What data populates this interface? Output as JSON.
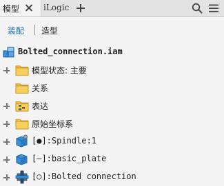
{
  "tabs": {
    "model_label": "模型",
    "ilogic_label": "iLogic"
  },
  "toolbar": {
    "assembly_label": "装配",
    "modeling_label": "造型"
  },
  "tree": {
    "root_label": "Bolted_connection.iam",
    "items": [
      {
        "label": "模型状态: 主要",
        "icon": "folder-icon",
        "expandable": true
      },
      {
        "label": "关系",
        "icon": "folder-icon",
        "expandable": false
      },
      {
        "label": "表达",
        "icon": "representations-folder-icon",
        "expandable": true
      },
      {
        "label": "原始坐标系",
        "icon": "folder-icon",
        "expandable": true
      },
      {
        "label": "[●]:Spindle:1",
        "icon": "part-icon",
        "expandable": true
      },
      {
        "label": "[–]:basic_plate",
        "icon": "part-icon",
        "expandable": true
      },
      {
        "label": "[○]:Bolted connection",
        "icon": "bolted-connection-icon",
        "expandable": true
      }
    ]
  },
  "colors": {
    "accent": "#1463b4",
    "folder": "#f5c242",
    "part_blue": "#3b8fd9"
  }
}
